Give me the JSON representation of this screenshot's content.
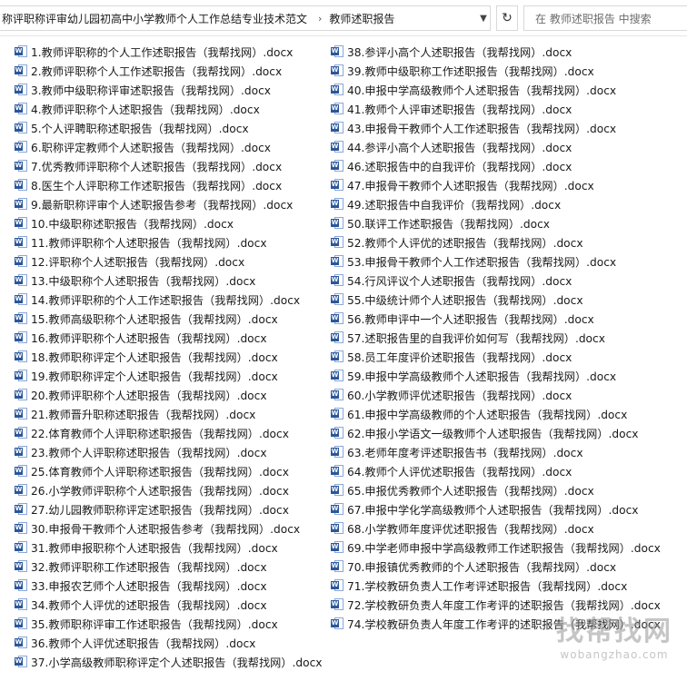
{
  "address": {
    "crumbs": [
      "称评职称评审幼儿园初高中小学教师个人工作总结专业技术范文",
      "教师述职报告"
    ],
    "separator": "›",
    "dropdown_icon": "chevron-down-icon",
    "refresh_icon": "refresh-icon"
  },
  "search": {
    "placeholder": "在 教师述职报告 中搜索"
  },
  "files_left": [
    "1.教师评职称的个人工作述职报告（我帮找网）.docx",
    "2.教师评职称个人工作述职报告（我帮找网）.docx",
    "3.教师中级职称评审述职报告（我帮找网）.docx",
    "4.教师评职称个人述职报告（我帮找网）.docx",
    "5.个人评聘职称述职报告（我帮找网）.docx",
    "6.职称评定教师个人述职报告（我帮找网）.docx",
    "7.优秀教师评职称个人述职报告（我帮找网）.docx",
    "8.医生个人评职称工作述职报告（我帮找网）.docx",
    "9.最新职称评审个人述职报告参考（我帮找网）.docx",
    "10.中级职称述职报告（我帮找网）.docx",
    "11.教师评职称个人述职报告（我帮找网）.docx",
    "12.评职称个人述职报告（我帮找网）.docx",
    "13.中级职称个人述职报告（我帮找网）.docx",
    "14.教师评职称的个人工作述职报告（我帮找网）.docx",
    "15.教师高级职称个人述职报告（我帮找网）.docx",
    "16.教师评职称个人述职报告（我帮找网）.docx",
    "18.教师职称评定个人述职报告（我帮找网）.docx",
    "19.教师职称评定个人述职报告（我帮找网）.docx",
    "20.教师评职称个人述职报告（我帮找网）.docx",
    "21.教师晋升职称述职报告（我帮找网）.docx",
    "22.体育教师个人评职称述职报告（我帮找网）.docx",
    "23.教师个人评职称述职报告（我帮找网）.docx",
    "25.体育教师个人评职称述职报告（我帮找网）.docx",
    "26.小学教师评职称个人述职报告（我帮找网）.docx",
    "27.幼儿园教师职称评定述职报告（我帮找网）.docx",
    "30.申报骨干教师个人述职报告参考（我帮找网）.docx",
    "31.教师申报职称个人述职报告（我帮找网）.docx",
    "32.教师评职称工作述职报告（我帮找网）.docx",
    "33.申报农艺师个人述职报告（我帮找网）.docx",
    "34.教师个人评优的述职报告（我帮找网）.docx",
    "35.教师职称评审工作述职报告（我帮找网）.docx",
    "36.教师个人评优述职报告（我帮找网）.docx",
    "37.小学高级教师职称评定个人述职报告（我帮找网）.docx"
  ],
  "files_right": [
    "38.参评小高个人述职报告（我帮找网）.docx",
    "39.教师中级职称工作述职报告（我帮找网）.docx",
    "40.申报中学高级教师个人述职报告（我帮找网）.docx",
    "41.教师个人评审述职报告（我帮找网）.docx",
    "43.申报骨干教师个人工作述职报告（我帮找网）.docx",
    "44.参评小高个人述职报告（我帮找网）.docx",
    "46.述职报告中的自我评价（我帮找网）.docx",
    "47.申报骨干教师个人述职报告（我帮找网）.docx",
    "49.述职报告中自我评价（我帮找网）.docx",
    "50.联评工作述职报告（我帮找网）.docx",
    "52.教师个人评优的述职报告（我帮找网）.docx",
    "53.申报骨干教师个人工作述职报告（我帮找网）.docx",
    "54.行风评议个人述职报告（我帮找网）.docx",
    "55.中级统计师个人述职报告（我帮找网）.docx",
    "56.教师申评中一个人述职报告（我帮找网）.docx",
    "57.述职报告里的自我评价如何写（我帮找网）.docx",
    "58.员工年度评价述职报告（我帮找网）.docx",
    "59.申报中学高级教师个人述职报告（我帮找网）.docx",
    "60.小学教师评优述职报告（我帮找网）.docx",
    "61.申报中学高级教师的个人述职报告（我帮找网）.docx",
    "62.申报小学语文一级教师个人述职报告（我帮找网）.docx",
    "63.老师年度考评述职报告书（我帮找网）.docx",
    "64.教师个人评优述职报告（我帮找网）.docx",
    "65.申报优秀教师个人述职报告（我帮找网）.docx",
    "67.申报中学化学高级教师个人述职报告（我帮找网）.docx",
    "68.小学教师年度评优述职报告（我帮找网）.docx",
    "69.中学老师申报中学高级教师工作述职报告（我帮找网）.docx",
    "70.申报镇优秀教师的个人述职报告（我帮找网）.docx",
    "71.学校教研负责人工作考评述职报告（我帮找网）.docx",
    "72.学校教研负责人年度工作考评的述职报告（我帮找网）.docx",
    "74.学校教研负责人年度工作考评的述职报告（我帮找网）.docx"
  ],
  "file_icon": "word-doc-icon",
  "watermark": {
    "logo": "找帮找网",
    "url": "wobangzhao.com"
  }
}
